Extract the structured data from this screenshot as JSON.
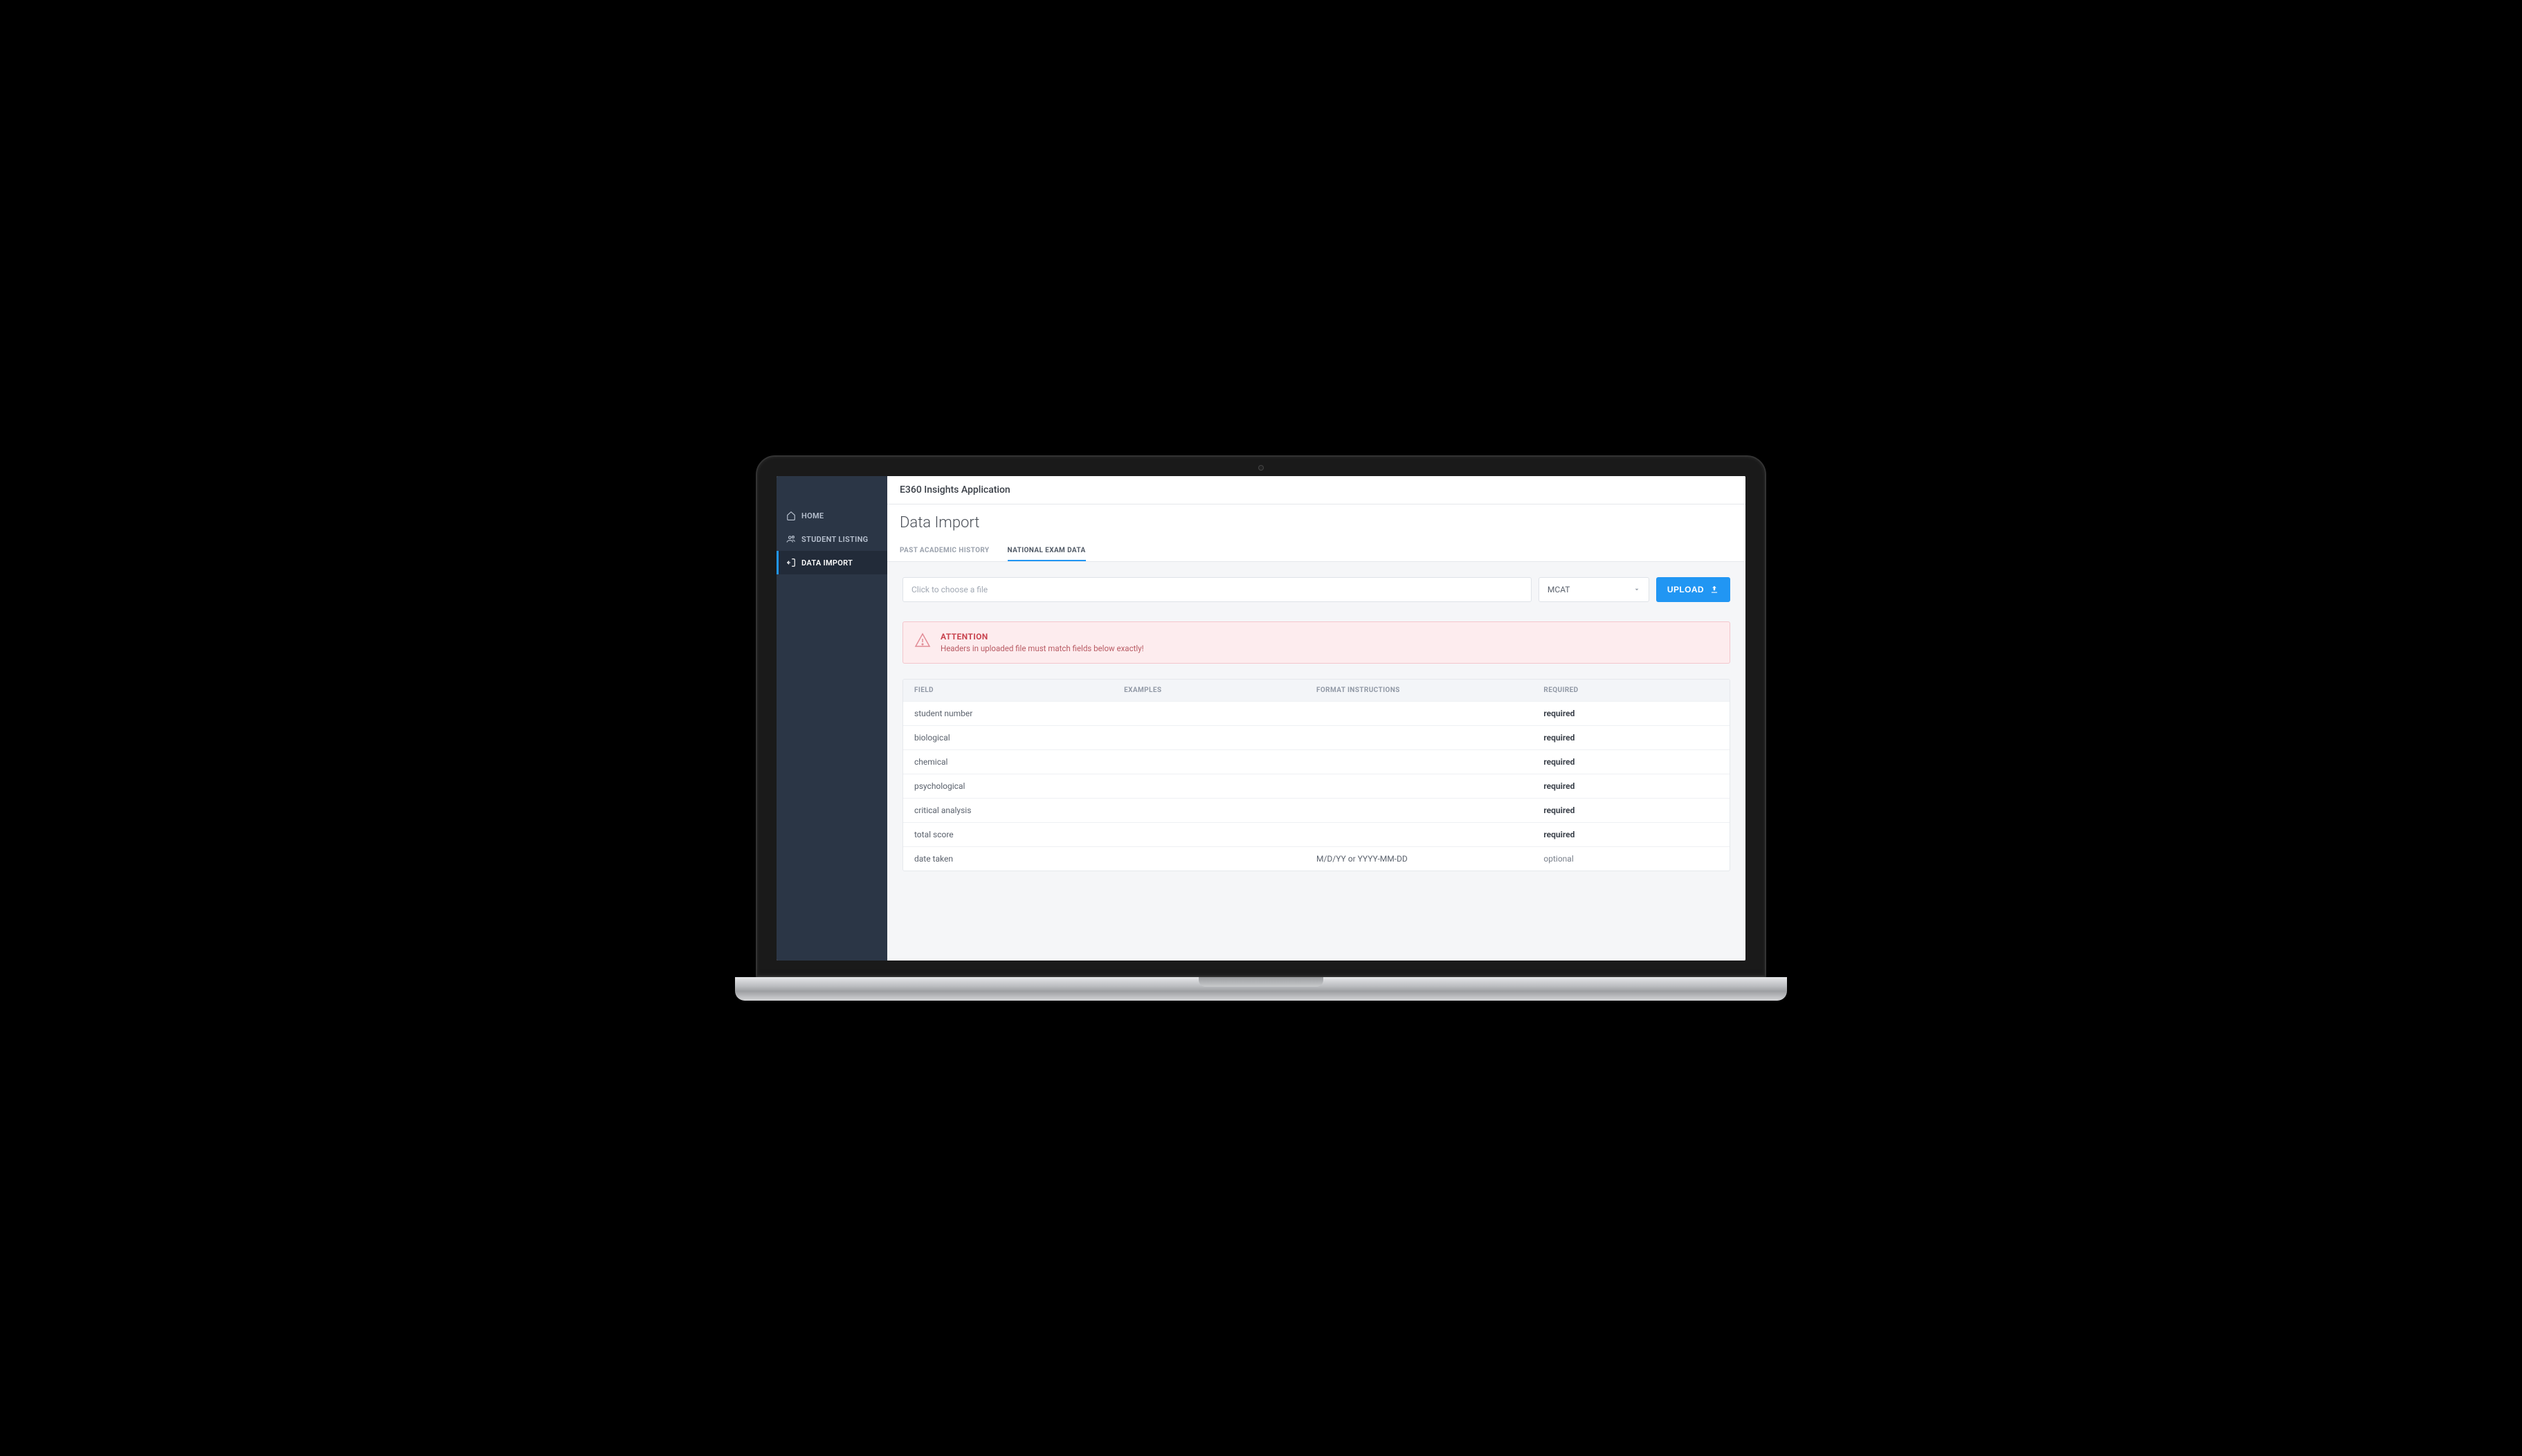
{
  "app": {
    "title": "E360 Insights Application"
  },
  "sidebar": {
    "items": [
      {
        "label": "HOME"
      },
      {
        "label": "STUDENT LISTING"
      },
      {
        "label": "DATA IMPORT"
      }
    ]
  },
  "page": {
    "title": "Data Import",
    "tabs": [
      {
        "label": "PAST ACADEMIC HISTORY"
      },
      {
        "label": "NATIONAL EXAM DATA"
      }
    ]
  },
  "upload": {
    "file_placeholder": "Click to choose a file",
    "select_value": "MCAT",
    "button_label": "UPLOAD"
  },
  "alert": {
    "title": "ATTENTION",
    "text": "Headers in uploaded file must match fields below exactly!"
  },
  "table": {
    "headers": {
      "field": "FIELD",
      "examples": "EXAMPLES",
      "format": "FORMAT INSTRUCTIONS",
      "required": "REQUIRED"
    },
    "rows": [
      {
        "field": "student number",
        "examples": "",
        "format": "",
        "required": "required",
        "req": true
      },
      {
        "field": "biological",
        "examples": "",
        "format": "",
        "required": "required",
        "req": true
      },
      {
        "field": "chemical",
        "examples": "",
        "format": "",
        "required": "required",
        "req": true
      },
      {
        "field": "psychological",
        "examples": "",
        "format": "",
        "required": "required",
        "req": true
      },
      {
        "field": "critical analysis",
        "examples": "",
        "format": "",
        "required": "required",
        "req": true
      },
      {
        "field": "total score",
        "examples": "",
        "format": "",
        "required": "required",
        "req": true
      },
      {
        "field": "date taken",
        "examples": "",
        "format": "M/D/YY or YYYY-MM-DD",
        "required": "optional",
        "req": false
      }
    ]
  }
}
